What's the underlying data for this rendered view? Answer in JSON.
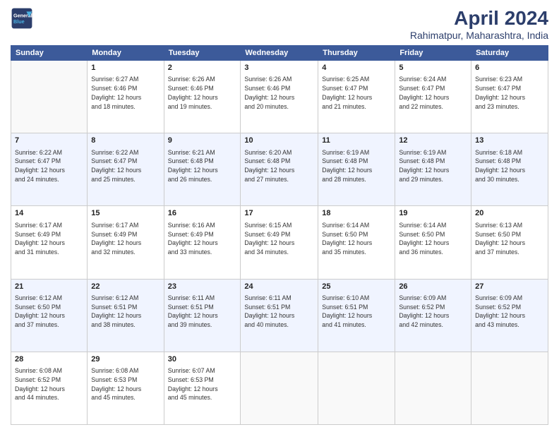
{
  "header": {
    "logo_line1": "General",
    "logo_line2": "Blue",
    "title": "April 2024",
    "subtitle": "Rahimatpur, Maharashtra, India"
  },
  "weekdays": [
    "Sunday",
    "Monday",
    "Tuesday",
    "Wednesday",
    "Thursday",
    "Friday",
    "Saturday"
  ],
  "weeks": [
    [
      {
        "day": "",
        "info": ""
      },
      {
        "day": "1",
        "info": "Sunrise: 6:27 AM\nSunset: 6:46 PM\nDaylight: 12 hours\nand 18 minutes."
      },
      {
        "day": "2",
        "info": "Sunrise: 6:26 AM\nSunset: 6:46 PM\nDaylight: 12 hours\nand 19 minutes."
      },
      {
        "day": "3",
        "info": "Sunrise: 6:26 AM\nSunset: 6:46 PM\nDaylight: 12 hours\nand 20 minutes."
      },
      {
        "day": "4",
        "info": "Sunrise: 6:25 AM\nSunset: 6:47 PM\nDaylight: 12 hours\nand 21 minutes."
      },
      {
        "day": "5",
        "info": "Sunrise: 6:24 AM\nSunset: 6:47 PM\nDaylight: 12 hours\nand 22 minutes."
      },
      {
        "day": "6",
        "info": "Sunrise: 6:23 AM\nSunset: 6:47 PM\nDaylight: 12 hours\nand 23 minutes."
      }
    ],
    [
      {
        "day": "7",
        "info": "Sunrise: 6:22 AM\nSunset: 6:47 PM\nDaylight: 12 hours\nand 24 minutes."
      },
      {
        "day": "8",
        "info": "Sunrise: 6:22 AM\nSunset: 6:47 PM\nDaylight: 12 hours\nand 25 minutes."
      },
      {
        "day": "9",
        "info": "Sunrise: 6:21 AM\nSunset: 6:48 PM\nDaylight: 12 hours\nand 26 minutes."
      },
      {
        "day": "10",
        "info": "Sunrise: 6:20 AM\nSunset: 6:48 PM\nDaylight: 12 hours\nand 27 minutes."
      },
      {
        "day": "11",
        "info": "Sunrise: 6:19 AM\nSunset: 6:48 PM\nDaylight: 12 hours\nand 28 minutes."
      },
      {
        "day": "12",
        "info": "Sunrise: 6:19 AM\nSunset: 6:48 PM\nDaylight: 12 hours\nand 29 minutes."
      },
      {
        "day": "13",
        "info": "Sunrise: 6:18 AM\nSunset: 6:48 PM\nDaylight: 12 hours\nand 30 minutes."
      }
    ],
    [
      {
        "day": "14",
        "info": "Sunrise: 6:17 AM\nSunset: 6:49 PM\nDaylight: 12 hours\nand 31 minutes."
      },
      {
        "day": "15",
        "info": "Sunrise: 6:17 AM\nSunset: 6:49 PM\nDaylight: 12 hours\nand 32 minutes."
      },
      {
        "day": "16",
        "info": "Sunrise: 6:16 AM\nSunset: 6:49 PM\nDaylight: 12 hours\nand 33 minutes."
      },
      {
        "day": "17",
        "info": "Sunrise: 6:15 AM\nSunset: 6:49 PM\nDaylight: 12 hours\nand 34 minutes."
      },
      {
        "day": "18",
        "info": "Sunrise: 6:14 AM\nSunset: 6:50 PM\nDaylight: 12 hours\nand 35 minutes."
      },
      {
        "day": "19",
        "info": "Sunrise: 6:14 AM\nSunset: 6:50 PM\nDaylight: 12 hours\nand 36 minutes."
      },
      {
        "day": "20",
        "info": "Sunrise: 6:13 AM\nSunset: 6:50 PM\nDaylight: 12 hours\nand 37 minutes."
      }
    ],
    [
      {
        "day": "21",
        "info": "Sunrise: 6:12 AM\nSunset: 6:50 PM\nDaylight: 12 hours\nand 37 minutes."
      },
      {
        "day": "22",
        "info": "Sunrise: 6:12 AM\nSunset: 6:51 PM\nDaylight: 12 hours\nand 38 minutes."
      },
      {
        "day": "23",
        "info": "Sunrise: 6:11 AM\nSunset: 6:51 PM\nDaylight: 12 hours\nand 39 minutes."
      },
      {
        "day": "24",
        "info": "Sunrise: 6:11 AM\nSunset: 6:51 PM\nDaylight: 12 hours\nand 40 minutes."
      },
      {
        "day": "25",
        "info": "Sunrise: 6:10 AM\nSunset: 6:51 PM\nDaylight: 12 hours\nand 41 minutes."
      },
      {
        "day": "26",
        "info": "Sunrise: 6:09 AM\nSunset: 6:52 PM\nDaylight: 12 hours\nand 42 minutes."
      },
      {
        "day": "27",
        "info": "Sunrise: 6:09 AM\nSunset: 6:52 PM\nDaylight: 12 hours\nand 43 minutes."
      }
    ],
    [
      {
        "day": "28",
        "info": "Sunrise: 6:08 AM\nSunset: 6:52 PM\nDaylight: 12 hours\nand 44 minutes."
      },
      {
        "day": "29",
        "info": "Sunrise: 6:08 AM\nSunset: 6:53 PM\nDaylight: 12 hours\nand 45 minutes."
      },
      {
        "day": "30",
        "info": "Sunrise: 6:07 AM\nSunset: 6:53 PM\nDaylight: 12 hours\nand 45 minutes."
      },
      {
        "day": "",
        "info": ""
      },
      {
        "day": "",
        "info": ""
      },
      {
        "day": "",
        "info": ""
      },
      {
        "day": "",
        "info": ""
      }
    ]
  ]
}
